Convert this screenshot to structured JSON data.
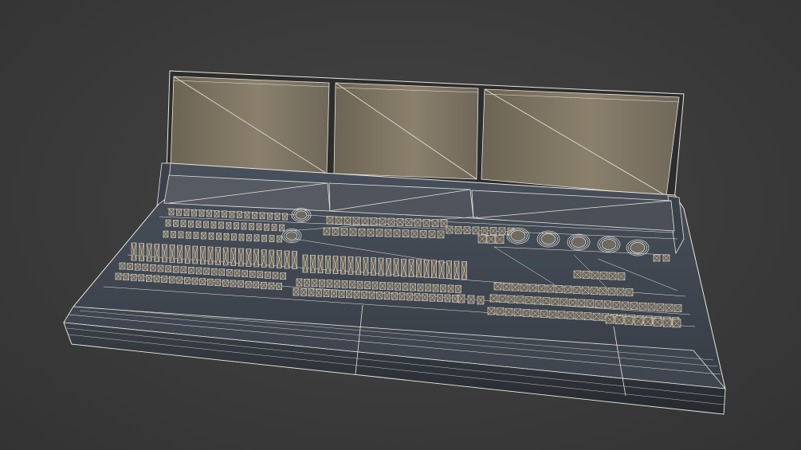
{
  "scene": {
    "subject": "lighting-console-wireframe-render",
    "colors": {
      "background": "#3b3b3b",
      "wire": "#e9e6dd",
      "screen_glass": "#8a806c",
      "screen_glass_light": "#5f584b",
      "console_body": "#3e4550",
      "console_front": "#2b2e33",
      "control_fill": "#6a6254"
    },
    "monitor_panels": 3,
    "lower_display_panels": 3,
    "encoder_rings_large": 5,
    "encoder_rings_small": 2
  }
}
